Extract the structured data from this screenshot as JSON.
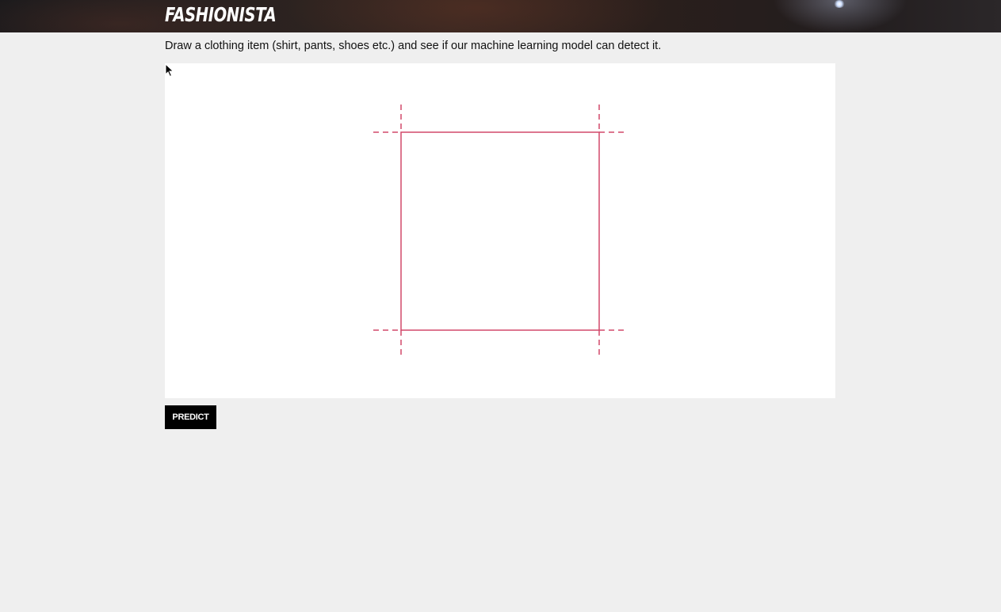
{
  "header": {
    "logo_text": "FASHIONISTA"
  },
  "main": {
    "instructions": "Draw a clothing item (shirt, pants, shoes etc.) and see if our machine learning model can detect it.",
    "predict_label": "PREDICT"
  },
  "colors": {
    "guide_line": "#d2486a",
    "button_bg": "#000000",
    "page_bg": "#efefef"
  },
  "icons": {
    "cursor": "mouse-pointer-icon"
  }
}
